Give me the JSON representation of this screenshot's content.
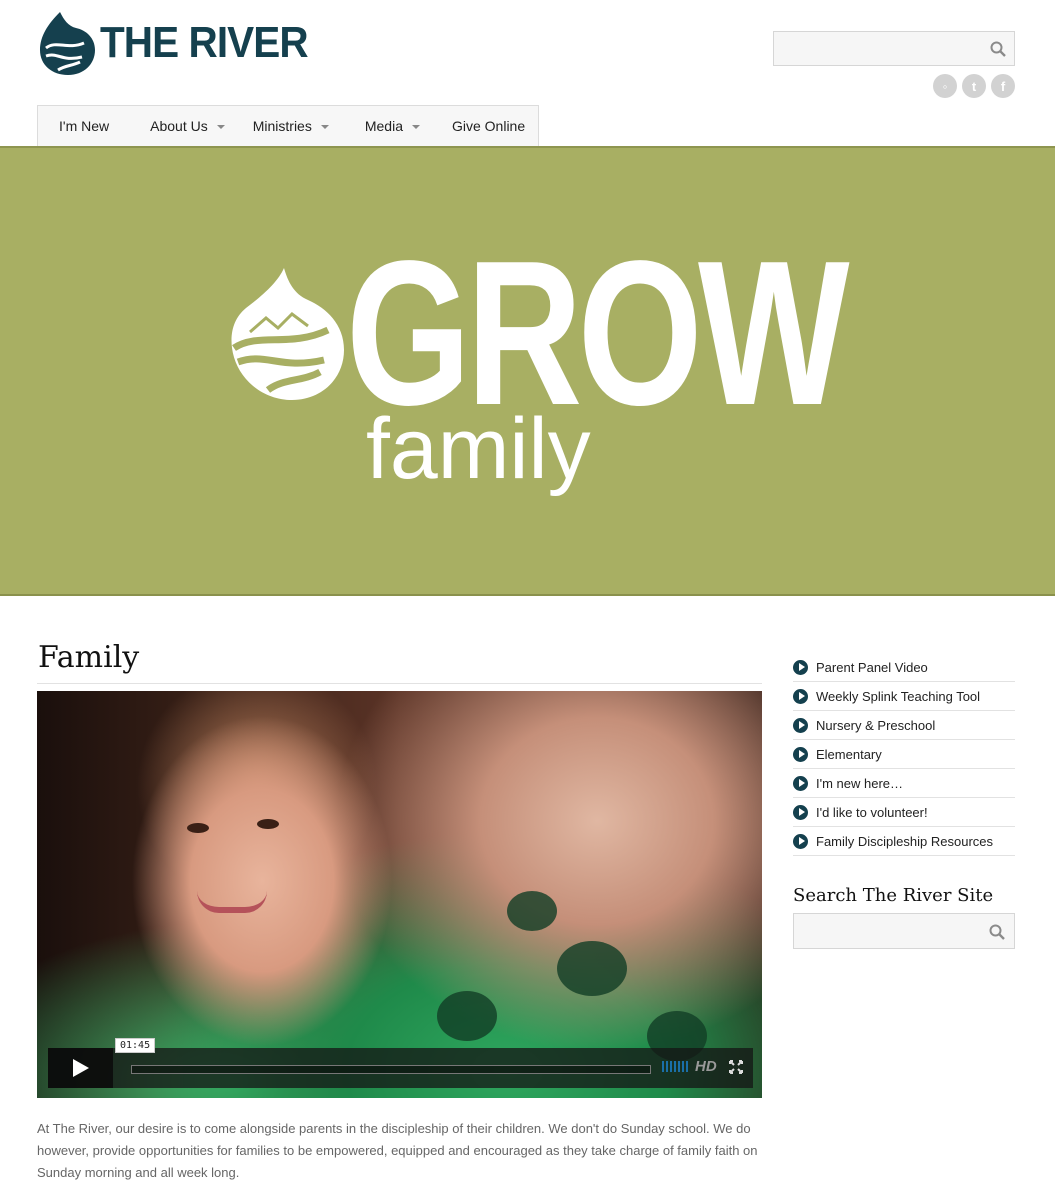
{
  "header": {
    "logo_text": "THE RIVER",
    "search_placeholder": "",
    "social": [
      "rss-icon",
      "twitter-icon",
      "facebook-icon"
    ],
    "social_glyphs": [
      "◦",
      "t",
      "f"
    ]
  },
  "nav": {
    "items": [
      {
        "label": "I'm New",
        "dropdown": false
      },
      {
        "label": "About Us",
        "dropdown": true
      },
      {
        "label": "Ministries",
        "dropdown": true
      },
      {
        "label": "Media",
        "dropdown": true
      },
      {
        "label": "Give Online",
        "dropdown": false
      }
    ]
  },
  "banner": {
    "title": "GROW",
    "subtitle": "family",
    "bg_color": "#a8af63"
  },
  "main": {
    "title": "Family",
    "video": {
      "timecode": "01:45",
      "hd_label": "HD"
    },
    "body": "At The River, our desire is to come alongside parents in the discipleship of their children.  We don't do Sunday school.  We do however, provide opportunities for families to be empowered, equipped and encouraged as they take charge of family faith on Sunday morning and all week long."
  },
  "sidebar": {
    "links": [
      "Parent Panel Video",
      "Weekly Splink Teaching Tool",
      "Nursery & Preschool",
      "Elementary",
      "I'm new here…",
      "I'd like to volunteer!",
      "Family Discipleship Resources"
    ],
    "search_heading": "Search The River Site",
    "search_placeholder": ""
  },
  "colors": {
    "brand": "#15404e",
    "banner": "#a8af63"
  }
}
